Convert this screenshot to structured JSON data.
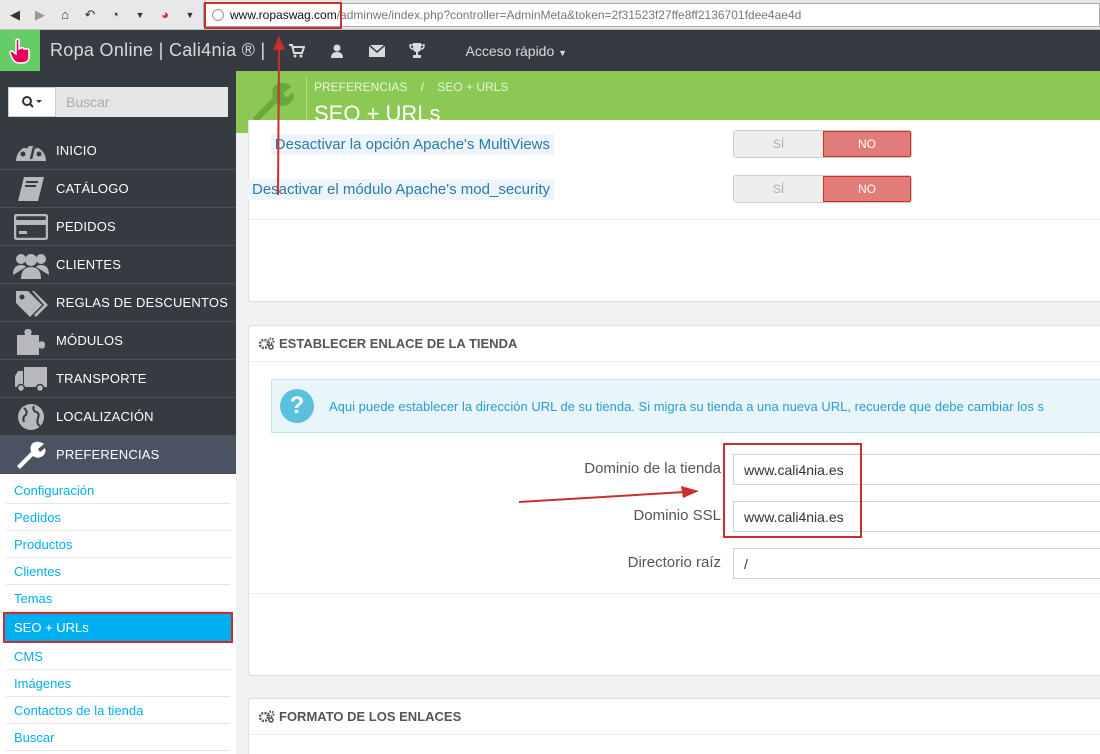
{
  "browser": {
    "url_domain": "www.ropaswag.com",
    "url_rest": "/adminwe/index.php?controller=AdminMeta&token=2f31523f27ffe8ff2136701fdee4ae4d",
    "url_prefix": ""
  },
  "header": {
    "shop_name": "Ropa Online | Cali4nia ® |",
    "quick_access": "Acceso rápido"
  },
  "sidebar": {
    "search_placeholder": "Buscar",
    "menu": [
      {
        "label": "INICIO",
        "icon": "dashboard-icon"
      },
      {
        "label": "CATÁLOGO",
        "icon": "book-icon"
      },
      {
        "label": "PEDIDOS",
        "icon": "credit-card-icon"
      },
      {
        "label": "CLIENTES",
        "icon": "users-icon"
      },
      {
        "label": "REGLAS DE DESCUENTOS",
        "icon": "tags-icon"
      },
      {
        "label": "MÓDULOS",
        "icon": "puzzle-icon"
      },
      {
        "label": "TRANSPORTE",
        "icon": "truck-icon"
      },
      {
        "label": "LOCALIZACIÓN",
        "icon": "globe-icon"
      },
      {
        "label": "PREFERENCIAS",
        "icon": "wrench-icon"
      }
    ],
    "submenu": [
      "Configuración",
      "Pedidos",
      "Productos",
      "Clientes",
      "Temas",
      "SEO + URLs",
      "CMS",
      "Imágenes",
      "Contactos de la tienda",
      "Buscar"
    ]
  },
  "page_head": {
    "breadcrumb_1": "PREFERENCIAS",
    "breadcrumb_sep": "/",
    "breadcrumb_2": "SEO + URLS",
    "title": "SEO + URLs"
  },
  "settings_panel": {
    "rows": [
      {
        "label": "Desactivar la opción Apache's MultiViews",
        "yes": "SÍ",
        "no": "NO"
      },
      {
        "label": "Desactivar el módulo Apache's mod_security",
        "yes": "SÍ",
        "no": "NO"
      }
    ]
  },
  "shop_url_panel": {
    "heading": "ESTABLECER ENLACE DE LA TIENDA",
    "info": "Aqui puede establecer la dirección URL de su tienda. Si migra su tienda a una nueva URL, recuerde que debe cambiar los s",
    "fields": [
      {
        "label": "Dominio de la tienda",
        "value": "www.cali4nia.es"
      },
      {
        "label": "Dominio SSL",
        "value": "www.cali4nia.es"
      },
      {
        "label": "Directorio raíz",
        "value": "/"
      }
    ]
  },
  "links_panel": {
    "heading": "FORMATO DE LOS ENLACES"
  }
}
